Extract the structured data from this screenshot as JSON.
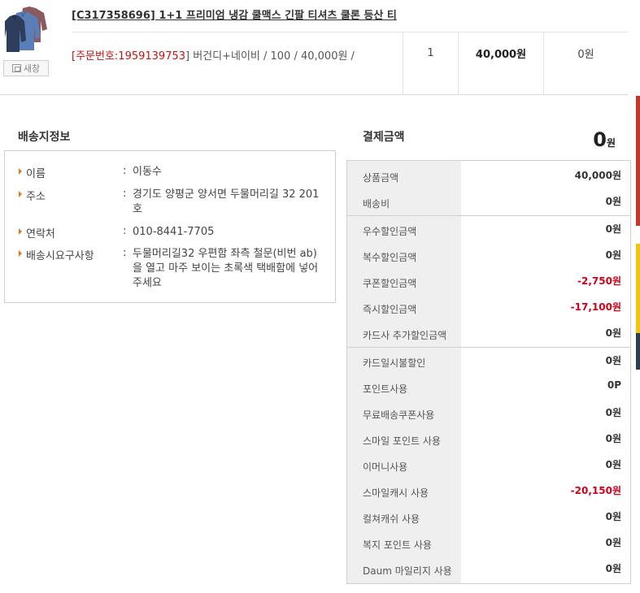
{
  "product": {
    "title": "[C317358696] 1+1 프리미엄 냉감 쿨맥스 긴팔 티셔츠 쿨론 등산 티",
    "new_window_label": "새창",
    "order_no_label": "[주문번호:",
    "order_no": "1959139753",
    "option_text": "] 버건디+네이비 / 100 / 40,000원 /",
    "quantity": "1",
    "amount": "40,000원",
    "discount": "0원"
  },
  "shipping": {
    "title": "배송지정보",
    "rows": [
      {
        "label": "이름",
        "value": "이동수"
      },
      {
        "label": "주소",
        "value": "경기도 양평군 양서면 두물머리길 32 201호"
      },
      {
        "label": "연락처",
        "value": "010-8441-7705"
      },
      {
        "label": "배송시요구사항",
        "value": "두물머리길32 우편함 좌측 철문(비번 ab)을 열고 마주 보이는 초록색 택배함에 넣어주세요"
      }
    ]
  },
  "payment": {
    "title": "결제금액",
    "total_value": "0",
    "total_unit": "원",
    "rows": [
      {
        "label": "상품금액",
        "value": "40,000원"
      },
      {
        "label": "배송비",
        "value": "0원"
      },
      {
        "label": "우수할인금액",
        "value": "0원"
      },
      {
        "label": "복수할인금액",
        "value": "0원"
      },
      {
        "label": "쿠폰할인금액",
        "value": "-2,750원"
      },
      {
        "label": "즉시할인금액",
        "value": "-17,100원"
      },
      {
        "label": "카드사 추가할인금액",
        "value": "0원"
      },
      {
        "label": "카드일시불할인",
        "value": "0원"
      },
      {
        "label": "포인트사용",
        "value": "0P"
      },
      {
        "label": "무료배송쿠폰사용",
        "value": "0원"
      },
      {
        "label": "스마일 포인트 사용",
        "value": "0원"
      },
      {
        "label": "이머니사용",
        "value": "0원"
      },
      {
        "label": "스마일캐시 사용",
        "value": "-20,150원"
      },
      {
        "label": "컬쳐캐쉬 사용",
        "value": "0원"
      },
      {
        "label": "복지 포인트 사용",
        "value": "0원"
      },
      {
        "label": "Daum 마일리지 사용",
        "value": "0원"
      }
    ]
  },
  "colors": {
    "accent_red": "#d0021b",
    "bullet_orange": "#e8791c",
    "label_bg": "#efefef"
  }
}
